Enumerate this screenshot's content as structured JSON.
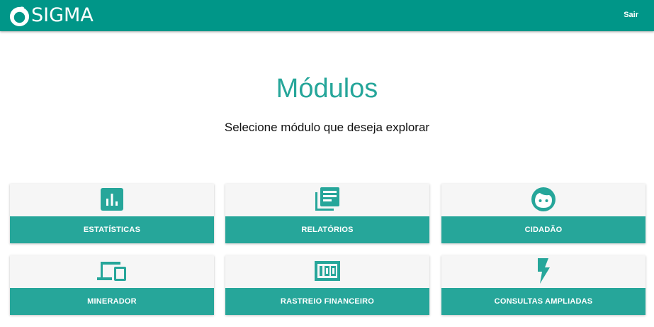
{
  "header": {
    "logo_text": "SIGMA",
    "logout_label": "Sair",
    "background_color": "#009688"
  },
  "main": {
    "title": "Módulos",
    "subtitle": "Selecione módulo que deseja explorar",
    "accent_color": "#26a69a",
    "modules": [
      {
        "label": "ESTATÍSTICAS",
        "icon": "bar-chart-icon"
      },
      {
        "label": "RELATÓRIOS",
        "icon": "newspaper-icon"
      },
      {
        "label": "CIDADÃO",
        "icon": "face-icon"
      },
      {
        "label": "MINERADOR",
        "icon": "devices-icon"
      },
      {
        "label": "RASTREIO FINANCEIRO",
        "icon": "money-icon"
      },
      {
        "label": "CONSULTAS AMPLIADAS",
        "icon": "flash-icon"
      }
    ]
  }
}
